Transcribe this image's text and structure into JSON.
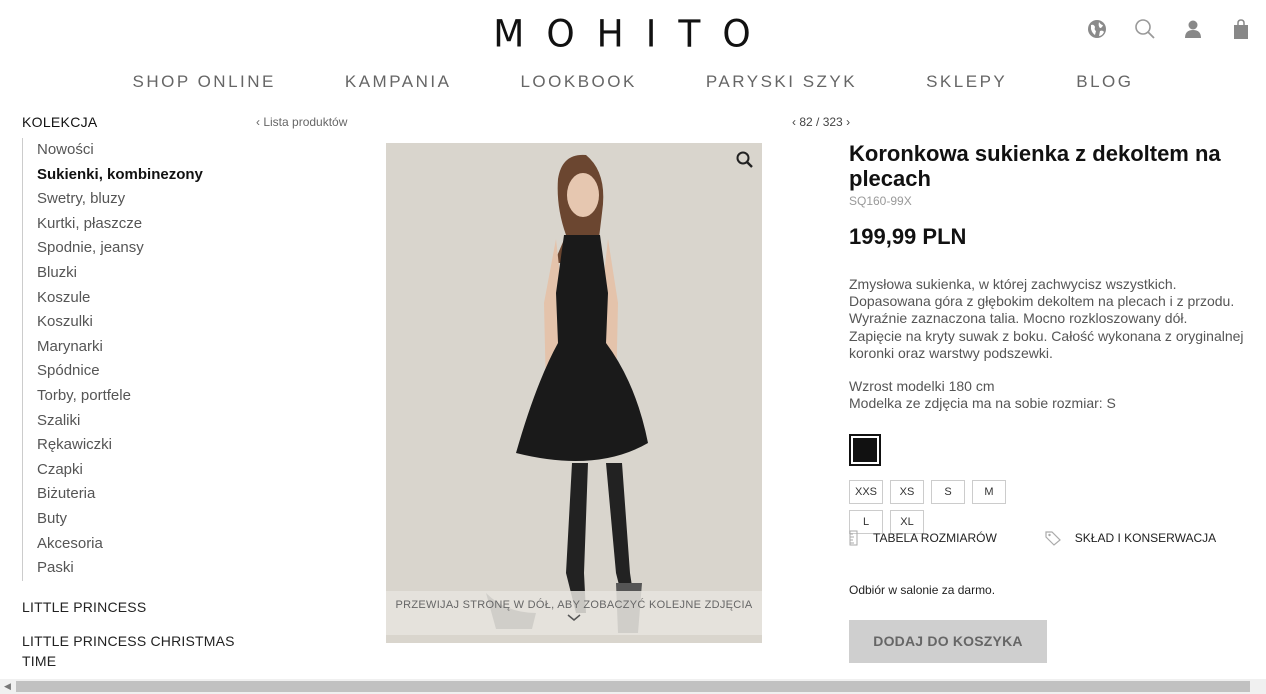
{
  "brand": {
    "logo": "MOHITO"
  },
  "header_icons": [
    "globe-icon",
    "search-icon",
    "user-icon",
    "bag-icon"
  ],
  "nav": [
    "SHOP ONLINE",
    "KAMPANIA",
    "LOOKBOOK",
    "PARYSKI SZYK",
    "SKLEPY",
    "BLOG"
  ],
  "sidebar": {
    "heading": "KOLEKCJA",
    "items": [
      {
        "label": "Nowości"
      },
      {
        "label": "Sukienki, kombinezony",
        "active": true
      },
      {
        "label": "Swetry, bluzy"
      },
      {
        "label": "Kurtki, płaszcze"
      },
      {
        "label": "Spodnie, jeansy"
      },
      {
        "label": "Bluzki"
      },
      {
        "label": "Koszule"
      },
      {
        "label": "Koszulki"
      },
      {
        "label": "Marynarki"
      },
      {
        "label": "Spódnice"
      },
      {
        "label": "Torby, portfele"
      },
      {
        "label": "Szaliki"
      },
      {
        "label": "Rękawiczki"
      },
      {
        "label": "Czapki"
      },
      {
        "label": "Biżuteria"
      },
      {
        "label": "Buty"
      },
      {
        "label": "Akcesoria"
      },
      {
        "label": "Paski"
      }
    ],
    "extra": [
      "LITTLE PRINCESS",
      "LITTLE PRINCESS CHRISTMAS TIME"
    ]
  },
  "breadcrumb": {
    "back": "Lista produktów",
    "pager": "82 / 323"
  },
  "gallery": {
    "scroll_hint": "PRZEWIJAJ STRONĘ W DÓŁ, ABY ZOBACZYĆ KOLEJNE ZDJĘCIA"
  },
  "product": {
    "title": "Koronkowa sukienka z dekoltem na plecach",
    "sku": "SQ160-99X",
    "price": "199,99 PLN",
    "description": "Zmysłowa sukienka, w której zachwycisz wszystkich. Dopasowana góra z głębokim dekoltem na plecach i z przodu. Wyraźnie zaznaczona talia. Mocno rozkloszowany dół. Zapięcie na kryty suwak z boku. Całość wykonana z oryginalnej koronki oraz warstwy podszewki.",
    "model_height": "Wzrost modelki 180 cm",
    "model_size": "Modelka ze zdjęcia ma na sobie rozmiar: S",
    "color_swatch": "#111111",
    "sizes": [
      "XXS",
      "XS",
      "S",
      "M",
      "L",
      "XL"
    ],
    "size_table": "TABELA ROZMIARÓW",
    "composition": "SKŁAD I KONSERWACJA",
    "pickup": "Odbiór w salonie za darmo.",
    "add_to_cart": "DODAJ DO KOSZYKA"
  }
}
